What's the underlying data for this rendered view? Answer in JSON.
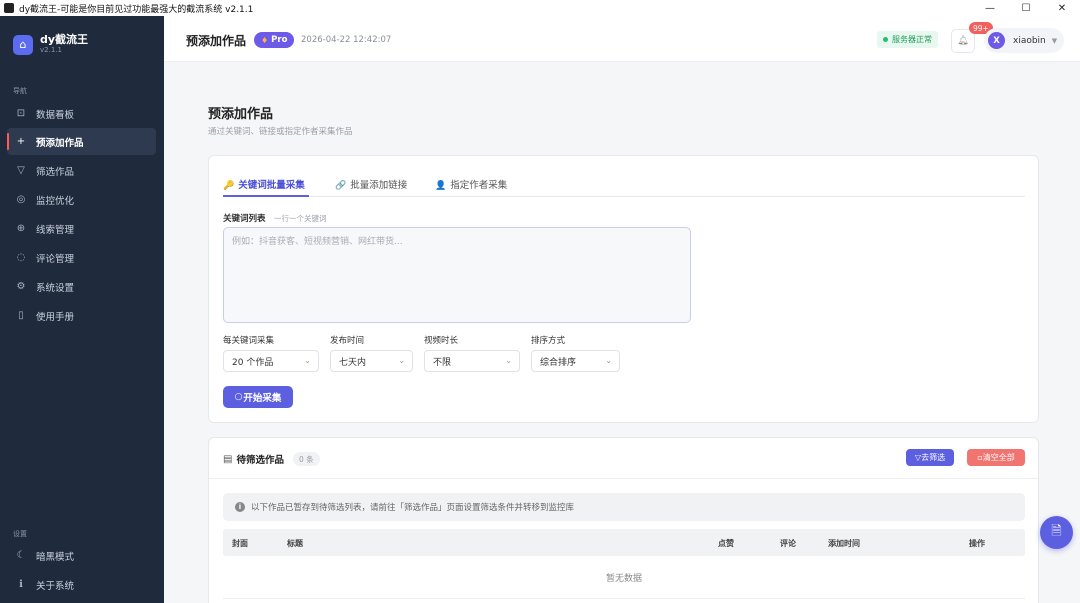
{
  "window": {
    "title": "dy截流王-可能是你目前见过功能最强大的截流系统 v2.1.1",
    "controls": {
      "minimize": "—",
      "maximize": "☐",
      "close": "✕"
    }
  },
  "sidebar": {
    "brand": {
      "name": "dy截流王",
      "version": "v2.1.1",
      "logo_icon": "app-logo-icon"
    },
    "nav_label": "导航",
    "items": [
      {
        "label": "数据看板",
        "icon": "chart-icon",
        "glyph": "⊡",
        "active": false
      },
      {
        "label": "预添加作品",
        "icon": "plus-icon",
        "glyph": "+",
        "active": true
      },
      {
        "label": "筛选作品",
        "icon": "filter-icon",
        "glyph": "▽",
        "active": false
      },
      {
        "label": "监控优化",
        "icon": "monitor-icon",
        "glyph": "◎",
        "active": false
      },
      {
        "label": "线索管理",
        "icon": "leads-icon",
        "glyph": "⊕",
        "active": false
      },
      {
        "label": "评论管理",
        "icon": "comment-icon",
        "glyph": "◌",
        "active": false
      },
      {
        "label": "系统设置",
        "icon": "gear-icon",
        "glyph": "⚙",
        "active": false
      },
      {
        "label": "使用手册",
        "icon": "book-icon",
        "glyph": "▯",
        "active": false
      }
    ],
    "settings_label": "设置",
    "bottom_items": [
      {
        "label": "暗黑模式",
        "icon": "moon-icon",
        "glyph": "☾"
      },
      {
        "label": "关于系统",
        "icon": "info-icon",
        "glyph": "ℹ"
      }
    ]
  },
  "header": {
    "title": "预添加作品",
    "pro_badge": "Pro",
    "datetime": "2026-04-22 12:42:07",
    "service_status": "服务器正常",
    "notification_count": "99+",
    "user": {
      "initial": "X",
      "name": "xiaobin"
    }
  },
  "main": {
    "page_title": "预添加作品",
    "page_subtitle": "通过关键词、链接或指定作者采集作品",
    "tabs": [
      {
        "label": "关键词批量采集",
        "icon": "key-icon",
        "glyph": "🔑",
        "active": true
      },
      {
        "label": "批量添加链接",
        "icon": "link-icon",
        "glyph": "🔗",
        "active": false
      },
      {
        "label": "指定作者采集",
        "icon": "user-icon",
        "glyph": "👤",
        "active": false
      }
    ],
    "keyword": {
      "label": "关键词列表",
      "hint": "一行一个关键词",
      "placeholder": "例如：抖音获客、短视频营销、网红带货..."
    },
    "filters": [
      {
        "label": "每关键词采集",
        "value": "20 个作品"
      },
      {
        "label": "发布时间",
        "value": "七天内"
      },
      {
        "label": "视频时长",
        "value": "不限"
      },
      {
        "label": "排序方式",
        "value": "综合排序"
      }
    ],
    "start_button": "开始采集",
    "pending": {
      "title": "待筛选作品",
      "count": "0 条",
      "filter_button": "去筛选",
      "clear_button": "清空全部",
      "notice": "以下作品已暂存到待筛选列表，请前往「筛选作品」页面设置筛选条件并转移到监控库",
      "columns": [
        "封面",
        "标题",
        "点赞",
        "评论",
        "添加时间",
        "操作"
      ],
      "empty_text": "暂无数据"
    }
  },
  "fab": {
    "icon": "document-icon"
  }
}
